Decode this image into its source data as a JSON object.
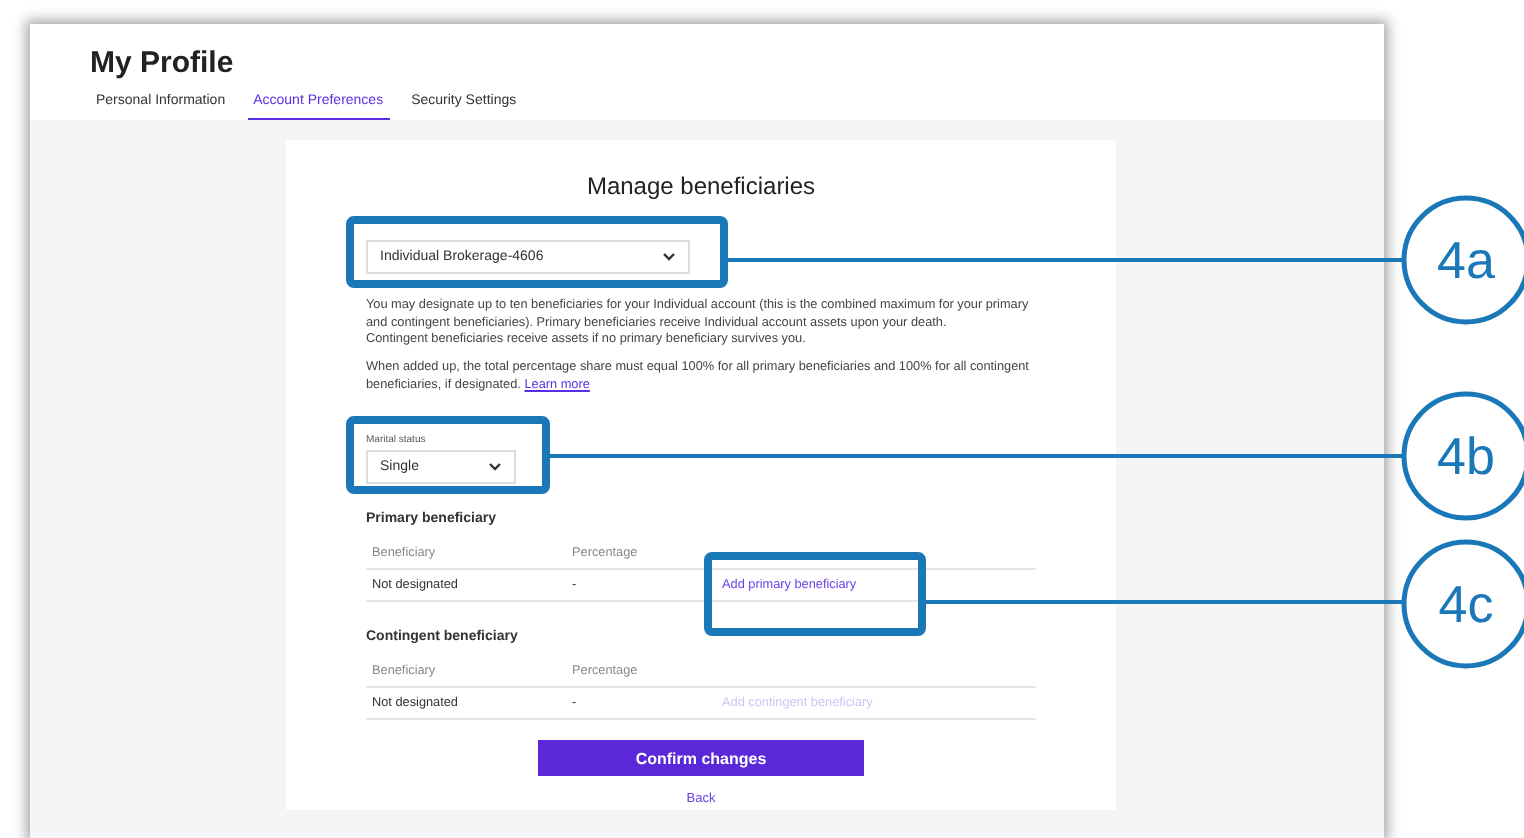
{
  "header": {
    "title": "My Profile"
  },
  "tabs": [
    {
      "label": "Personal Information",
      "selected": false
    },
    {
      "label": "Account Preferences",
      "selected": true
    },
    {
      "label": "Security Settings",
      "selected": false
    }
  ],
  "card": {
    "title": "Manage beneficiaries",
    "account_select": {
      "value": "Individual Brokerage-4606"
    },
    "intro": [
      "You may designate up to ten beneficiaries for your Individual account (this is the combined maximum for your primary and contingent beneficiaries). Primary beneficiaries receive Individual account assets upon your death.",
      "Contingent beneficiaries receive assets if no primary beneficiary survives you."
    ],
    "note": {
      "text": "When added up, the total percentage share must equal 100% for all primary beneficiaries and 100% for all contingent beneficiaries, if designated.",
      "link": "Learn more"
    },
    "marital_status": {
      "label": "Marital status",
      "value": "Single"
    },
    "sections": [
      {
        "heading": "Primary beneficiary",
        "columns": [
          "Beneficiary",
          "Percentage"
        ],
        "rows": [
          {
            "beneficiary": "Not designated",
            "percentage": "-",
            "action": {
              "label": "Add primary beneficiary",
              "disabled": false
            }
          }
        ]
      },
      {
        "heading": "Contingent beneficiary",
        "columns": [
          "Beneficiary",
          "Percentage"
        ],
        "rows": [
          {
            "beneficiary": "Not designated",
            "percentage": "-",
            "action": {
              "label": "Add contingent beneficiary",
              "disabled": true
            }
          }
        ]
      }
    ],
    "confirm_button": "Confirm changes",
    "back_link": "Back"
  },
  "callouts": [
    {
      "label": "4a"
    },
    {
      "label": "4b"
    },
    {
      "label": "4c"
    }
  ]
}
